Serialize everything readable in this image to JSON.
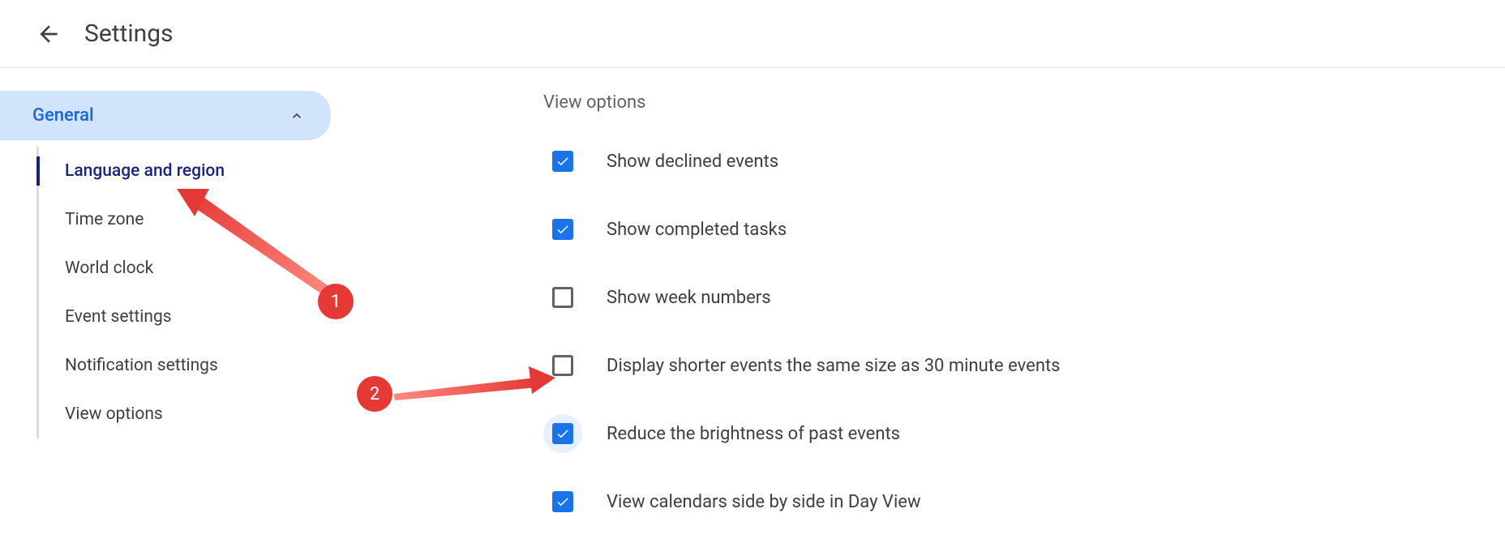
{
  "header": {
    "title": "Settings"
  },
  "sidebar": {
    "category": "General",
    "items": [
      {
        "label": "Language and region",
        "active": true
      },
      {
        "label": "Time zone",
        "active": false
      },
      {
        "label": "World clock",
        "active": false
      },
      {
        "label": "Event settings",
        "active": false
      },
      {
        "label": "Notification settings",
        "active": false
      },
      {
        "label": "View options",
        "active": false
      }
    ]
  },
  "main": {
    "section_title": "View options",
    "options": [
      {
        "label": "Show declined events",
        "checked": true,
        "highlighted": false
      },
      {
        "label": "Show completed tasks",
        "checked": true,
        "highlighted": false
      },
      {
        "label": "Show week numbers",
        "checked": false,
        "highlighted": false
      },
      {
        "label": "Display shorter events the same size as 30 minute events",
        "checked": false,
        "highlighted": false
      },
      {
        "label": "Reduce the brightness of past events",
        "checked": true,
        "highlighted": true
      },
      {
        "label": "View calendars side by side in Day View",
        "checked": true,
        "highlighted": false
      }
    ]
  },
  "annotations": [
    {
      "number": "1"
    },
    {
      "number": "2"
    }
  ]
}
